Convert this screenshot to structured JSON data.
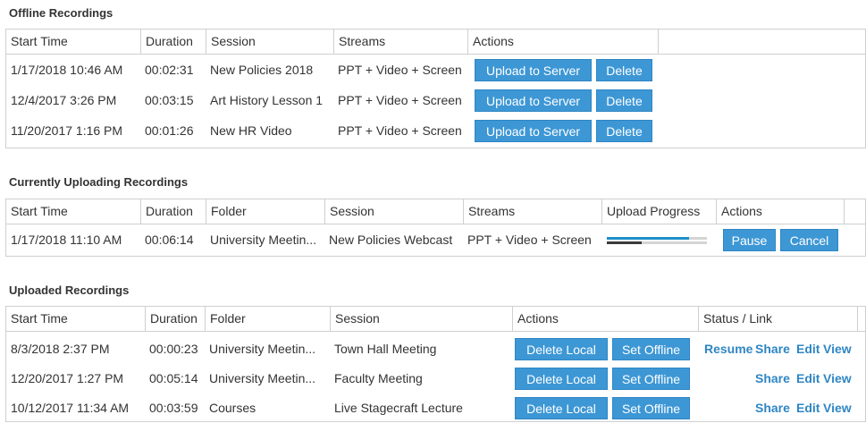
{
  "offline": {
    "title": "Offline Recordings",
    "columns": [
      "Start Time",
      "Duration",
      "Session",
      "Streams",
      "Actions"
    ],
    "upload_label": "Upload to Server",
    "delete_label": "Delete",
    "rows": [
      {
        "start": "1/17/2018 10:46 AM",
        "duration": "00:02:31",
        "session": "New Policies 2018",
        "streams": "PPT + Video + Screen"
      },
      {
        "start": "12/4/2017 3:26 PM",
        "duration": "00:03:15",
        "session": "Art History Lesson 1",
        "streams": "PPT + Video + Screen"
      },
      {
        "start": "11/20/2017 1:16 PM",
        "duration": "00:01:26",
        "session": "New HR Video",
        "streams": "PPT + Video + Screen"
      }
    ]
  },
  "uploading": {
    "title": "Currently Uploading Recordings",
    "columns": [
      "Start Time",
      "Duration",
      "Folder",
      "Session",
      "Streams",
      "Upload Progress",
      "Actions"
    ],
    "pause_label": "Pause",
    "cancel_label": "Cancel",
    "rows": [
      {
        "start": "1/17/2018 11:10 AM",
        "duration": "00:06:14",
        "folder": "University Meetin...",
        "session": "New Policies Webcast",
        "streams": "PPT + Video + Screen",
        "progress_primary": 0.82,
        "progress_secondary": 0.35
      }
    ]
  },
  "uploaded": {
    "title": "Uploaded Recordings",
    "columns": [
      "Start Time",
      "Duration",
      "Folder",
      "Session",
      "Actions",
      "Status / Link"
    ],
    "delete_local_label": "Delete Local",
    "set_offline_label": "Set Offline",
    "link_resume": "Resume",
    "link_share": "Share",
    "link_edit": "Edit",
    "link_view": "View",
    "rows": [
      {
        "start": "8/3/2018 2:37 PM",
        "duration": "00:00:23",
        "folder": "University Meetin...",
        "session": "Town Hall Meeting",
        "resumable": true
      },
      {
        "start": "12/20/2017 1:27 PM",
        "duration": "00:05:14",
        "folder": "University Meetin...",
        "session": "Faculty Meeting",
        "resumable": false
      },
      {
        "start": "10/12/2017 11:34 AM",
        "duration": "00:03:59",
        "folder": "Courses",
        "session": "Live Stagecraft Lecture",
        "resumable": false
      }
    ]
  },
  "colors": {
    "accent": "#3d97d5",
    "link": "#2f86c4",
    "progress_primary": "#1f8fc9",
    "progress_secondary": "#3a3a3a",
    "progress_track": "#d4d4d4"
  }
}
